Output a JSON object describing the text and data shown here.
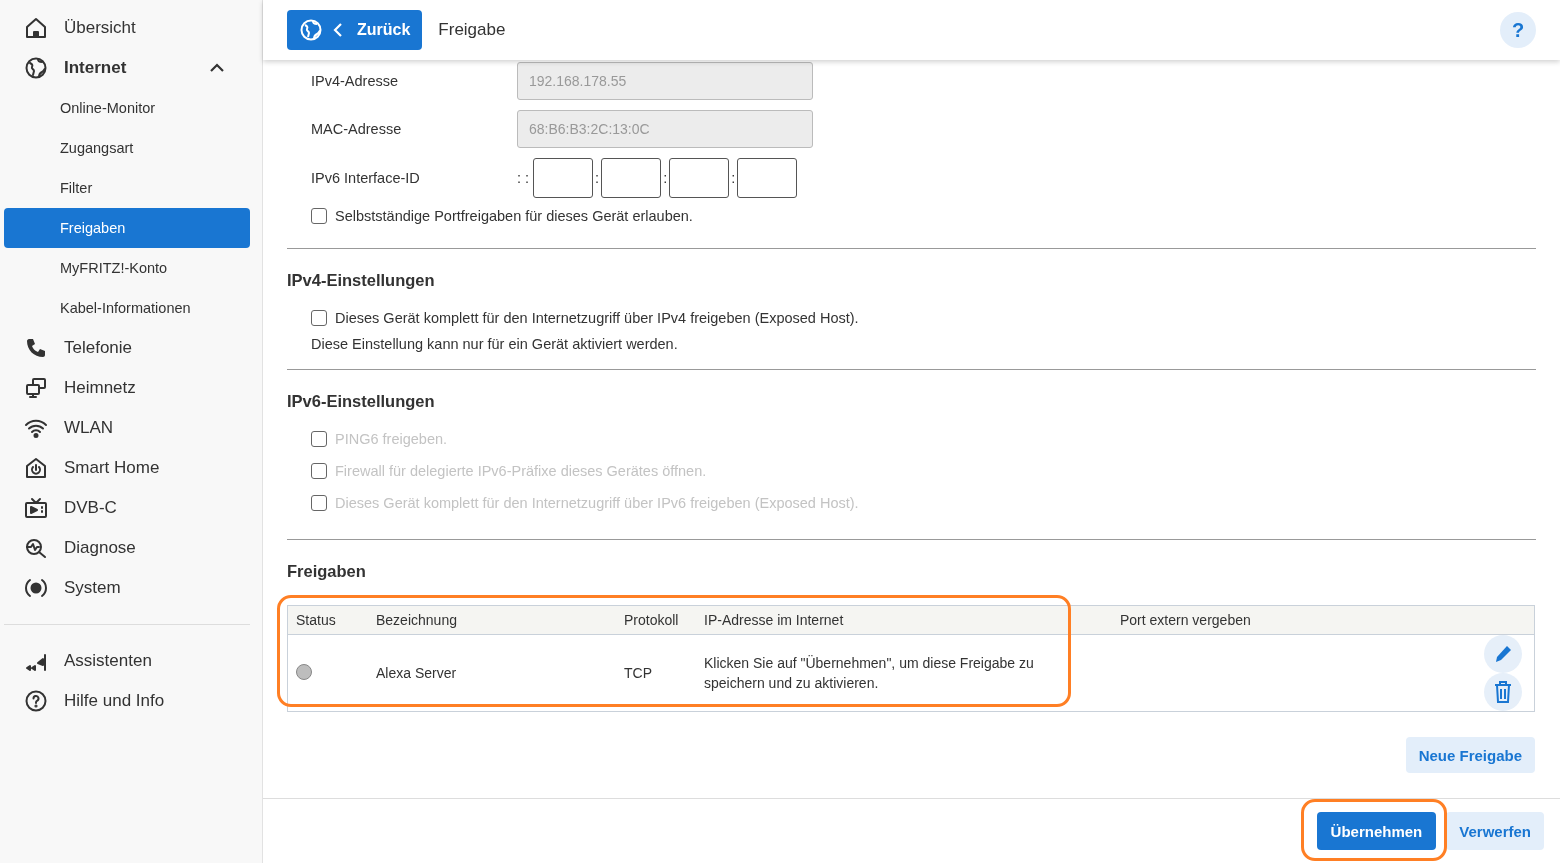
{
  "sidebar": {
    "items": [
      {
        "label": "Übersicht",
        "selected": false
      },
      {
        "label": "Internet",
        "selected": false,
        "expanded": true,
        "children": [
          {
            "label": "Online-Monitor",
            "selected": false
          },
          {
            "label": "Zugangsart",
            "selected": false
          },
          {
            "label": "Filter",
            "selected": false
          },
          {
            "label": "Freigaben",
            "selected": true
          },
          {
            "label": "MyFRITZ!-Konto",
            "selected": false
          },
          {
            "label": "Kabel-Informationen",
            "selected": false
          }
        ]
      },
      {
        "label": "Telefonie",
        "selected": false
      },
      {
        "label": "Heimnetz",
        "selected": false
      },
      {
        "label": "WLAN",
        "selected": false
      },
      {
        "label": "Smart Home",
        "selected": false
      },
      {
        "label": "DVB-C",
        "selected": false
      },
      {
        "label": "Diagnose",
        "selected": false
      },
      {
        "label": "System",
        "selected": false
      }
    ],
    "bottom_items": [
      {
        "label": "Assistenten",
        "selected": false
      },
      {
        "label": "Hilfe und Info",
        "selected": false
      }
    ]
  },
  "header": {
    "back_button": "Zurück",
    "title": "Freigabe",
    "help": "?"
  },
  "device": {
    "fields": [
      {
        "label": "IPv4-Adresse",
        "value": "192.168.178.55",
        "disabled": true
      },
      {
        "label": "MAC-Adresse",
        "value": "68:B6:B3:2C:13:0C",
        "disabled": true
      }
    ],
    "ipv6_interface_id": {
      "label": "IPv6 Interface-ID",
      "separators": [
        ": :",
        ":",
        ":",
        ":"
      ]
    },
    "checkboxes": [
      {
        "label": "Selbstständige Portfreigaben für dieses Gerät erlauben.",
        "checked": false,
        "disabled": false
      }
    ]
  },
  "ipv4_settings": {
    "title": "IPv4-Einstellungen",
    "checkboxes": [
      {
        "label": "Dieses Gerät komplett für den Internetzugriff über IPv4 freigeben (Exposed Host).",
        "checked": false,
        "disabled": false
      }
    ],
    "note": "Diese Einstellung kann nur für ein Gerät aktiviert werden."
  },
  "ipv6_settings": {
    "title": "IPv6-Einstellungen",
    "checkboxes": [
      {
        "label": "PING6 freigeben.",
        "checked": false,
        "disabled": true
      },
      {
        "label": "Firewall für delegierte IPv6-Präfixe dieses Gerätes öffnen.",
        "checked": false,
        "disabled": true
      },
      {
        "label": "Dieses Gerät komplett für den Internetzugriff über IPv6 freigeben (Exposed Host).",
        "checked": false,
        "disabled": true
      }
    ]
  },
  "shares": {
    "title": "Freigaben",
    "table": {
      "columns": [
        "Status",
        "Bezeichnung",
        "Protokoll",
        "IP-Adresse im Internet",
        "Port extern vergeben"
      ],
      "rows": [
        {
          "active": false,
          "name": "Alexa Server",
          "protocol": "TCP",
          "ip": "Klicken Sie auf \"Übernehmen\", um diese Freigabe zu speichern und zu aktivieren."
        }
      ]
    },
    "new_button": "Neue Freigabe"
  },
  "footer": {
    "buttons": [
      {
        "label": "Übernehmen",
        "kind": "primary"
      },
      {
        "label": "Verwerfen",
        "kind": "secondary"
      }
    ]
  }
}
